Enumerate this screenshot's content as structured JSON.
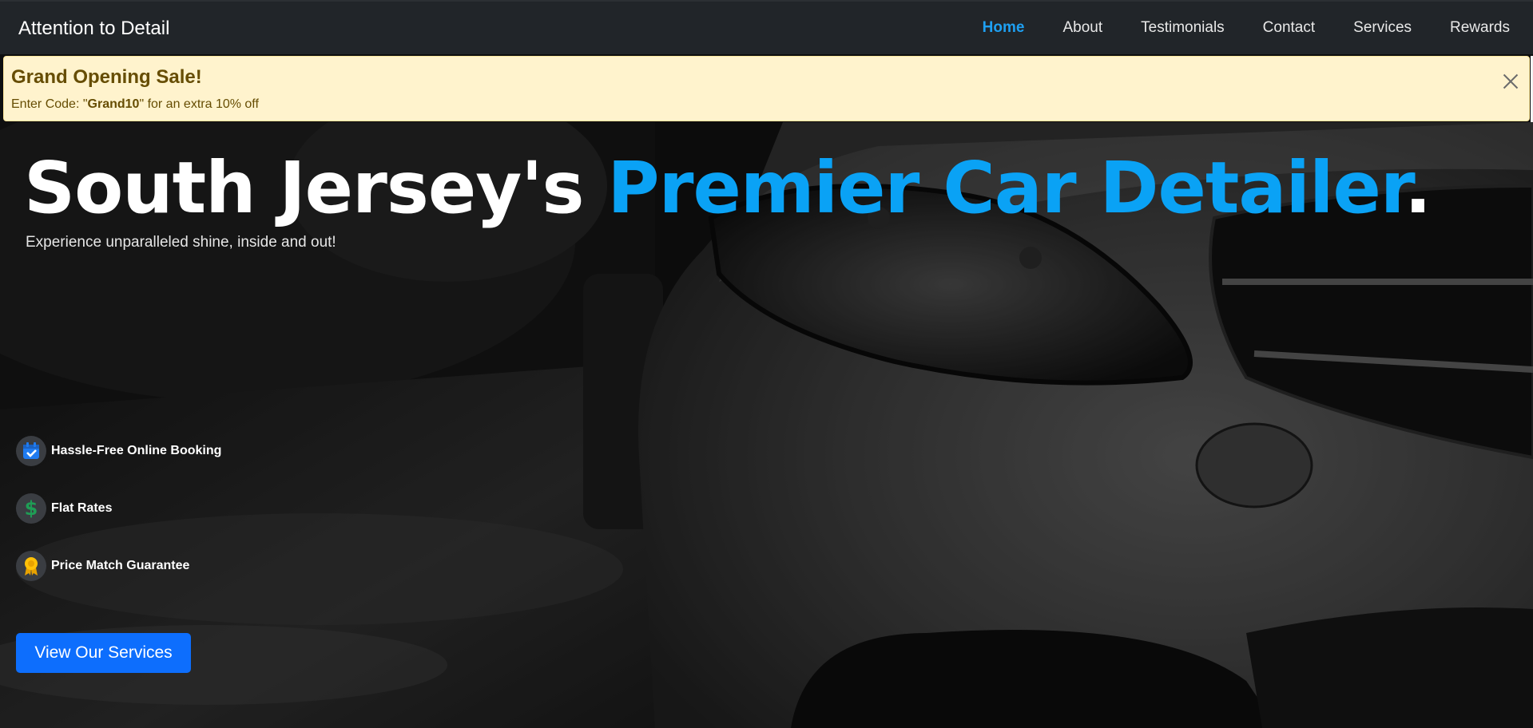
{
  "brand": "Attention to Detail",
  "nav": {
    "items": [
      {
        "label": "Home"
      },
      {
        "label": "About"
      },
      {
        "label": "Testimonials"
      },
      {
        "label": "Contact"
      },
      {
        "label": "Services"
      },
      {
        "label": "Rewards"
      }
    ],
    "active": "Home"
  },
  "alert": {
    "title": "Grand Opening Sale!",
    "text_before": "Enter Code: \"",
    "code": "Grand10",
    "text_after": "\" for an extra 10% off",
    "close_icon": "close-icon"
  },
  "hero": {
    "title_part1": "South Jersey's ",
    "title_highlight": "Premier Car Detailer",
    "title_end": ".",
    "subtitle": "Experience unparalleled shine, inside and out!",
    "features": [
      {
        "label": "Hassle-Free Online Booking",
        "icon": "calendar-check-icon"
      },
      {
        "label": "Flat Rates",
        "icon": "dollar-icon"
      },
      {
        "label": "Price Match Guarantee",
        "icon": "award-icon"
      }
    ],
    "cta_label": "View Our Services",
    "background": "car-front-photo"
  },
  "colors": {
    "navbar_bg": "#212529",
    "accent": "#0aa2f5",
    "nav_active": "#1ea0f2",
    "alert_bg": "#fff3cd",
    "alert_text": "#664d03",
    "button": "#0d6efd"
  }
}
